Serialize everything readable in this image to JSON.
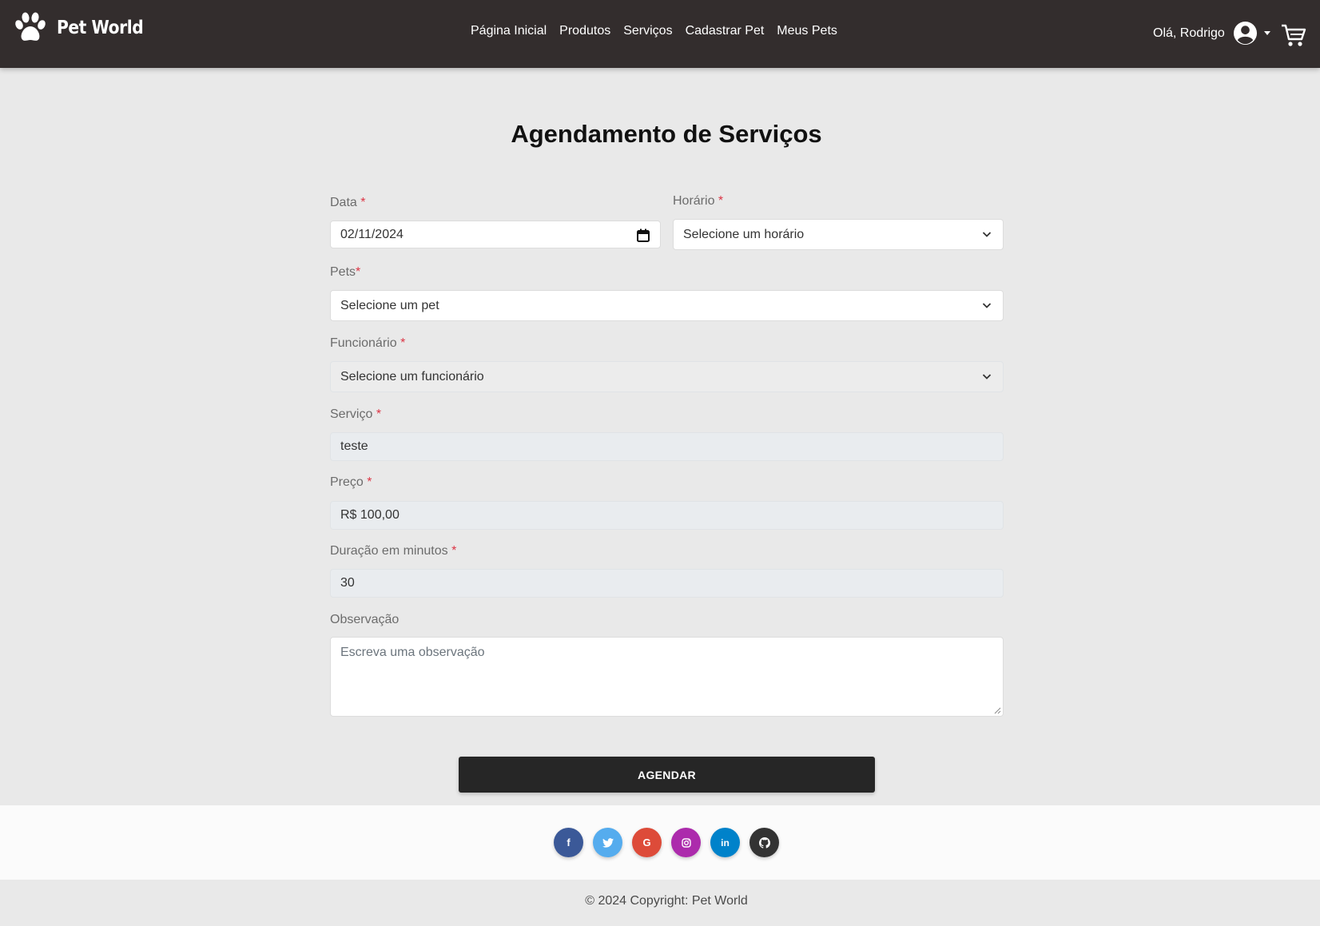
{
  "brand": {
    "name": "Pet World",
    "icon": "paw-icon"
  },
  "nav": {
    "items": [
      "Página Inicial",
      "Produtos",
      "Serviços",
      "Cadastrar Pet",
      "Meus Pets"
    ]
  },
  "user": {
    "greeting": "Olá, Rodrigo",
    "avatar_icon": "user-circle-icon",
    "cart_icon": "cart-icon"
  },
  "page": {
    "title": "Agendamento de Serviços"
  },
  "form": {
    "required_mark": "*",
    "data": {
      "label": "Data",
      "value": "02/11/2024"
    },
    "horario": {
      "label": "Horário",
      "value": "Selecione um horário"
    },
    "pets": {
      "label": "Pets",
      "value": "Selecione um pet"
    },
    "funcionario": {
      "label": "Funcionário",
      "value": "Selecione um funcionário"
    },
    "servico": {
      "label": "Serviço",
      "value": "teste"
    },
    "preco": {
      "label": "Preço",
      "value": "R$ 100,00"
    },
    "duracao": {
      "label": "Duração em minutos",
      "value": "30"
    },
    "observacao": {
      "label": "Observação",
      "placeholder": "Escreva uma observação"
    },
    "submit_label": "AGENDAR"
  },
  "social": [
    {
      "name": "facebook",
      "glyph": "f",
      "color": "#3b5998"
    },
    {
      "name": "twitter",
      "glyph": "t",
      "color": "#55acee"
    },
    {
      "name": "google",
      "glyph": "G",
      "color": "#dd4b39"
    },
    {
      "name": "instagram",
      "glyph": "◎",
      "color": "#ac2bac"
    },
    {
      "name": "linkedin",
      "glyph": "in",
      "color": "#0082ca"
    },
    {
      "name": "github",
      "glyph": "●",
      "color": "#333333"
    }
  ],
  "footer": {
    "copyright": "© 2024 Copyright: Pet World"
  },
  "colors": {
    "navbar": "#332d2d",
    "background": "#e9e9e9",
    "button": "#262626",
    "required": "#dc3545"
  }
}
